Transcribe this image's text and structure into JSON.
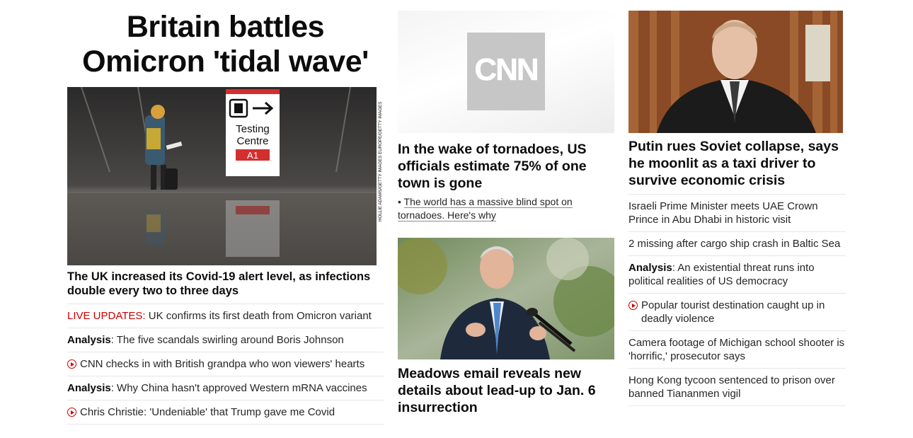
{
  "left": {
    "headline_line1": "Britain battles",
    "headline_line2": "Omicron 'tidal wave'",
    "image_sign_line1": "Testing",
    "image_sign_line2": "Centre",
    "image_sign_gate": "A1",
    "image_credit": "HOLLIE ADAMS/GETTY IMAGES EUROPE/GETTY IMAGES",
    "caption": "The UK increased its Covid-19 alert level, as infections double every two to three days",
    "list": [
      {
        "prefix": "LIVE UPDATES:",
        "text": " UK confirms its first death from Omicron variant",
        "type": "live"
      },
      {
        "prefix": "Analysis",
        "text": ": The five scandals swirling around Boris Johnson",
        "type": "analysis"
      },
      {
        "prefix": "",
        "text": "CNN checks in with British grandpa who won viewers' hearts",
        "type": "video"
      },
      {
        "prefix": "Analysis",
        "text": ": Why China hasn't approved Western mRNA vaccines",
        "type": "analysis"
      },
      {
        "prefix": "",
        "text": "Chris Christie: 'Undeniable' that Trump gave me Covid",
        "type": "video"
      }
    ]
  },
  "middle": {
    "logo_text": "CNN",
    "story1_headline": "In the wake of tornadoes, US officials estimate 75% of one town is gone",
    "story1_sublink": "The world has a massive blind spot on tornadoes. Here's why",
    "story2_headline": "Meadows email reveals new details about lead-up to Jan. 6 insurrection"
  },
  "right": {
    "headline": "Putin rues Soviet collapse, says he moonlit as a taxi driver to survive economic crisis",
    "list": [
      {
        "prefix": "",
        "text": "Israeli Prime Minister meets UAE Crown Prince in Abu Dhabi in historic visit",
        "type": "plain"
      },
      {
        "prefix": "",
        "text": "2 missing after cargo ship crash in Baltic Sea",
        "type": "plain"
      },
      {
        "prefix": "Analysis",
        "text": ": An existential threat runs into political realities of US democracy",
        "type": "analysis"
      },
      {
        "prefix": "",
        "text": "Popular tourist destination caught up in deadly violence",
        "type": "video"
      },
      {
        "prefix": "",
        "text": "Camera footage of Michigan school shooter is 'horrific,' prosecutor says",
        "type": "plain"
      },
      {
        "prefix": "",
        "text": "Hong Kong tycoon sentenced to prison over banned Tiananmen vigil",
        "type": "plain"
      }
    ]
  },
  "colors": {
    "live_red": "#cc0000",
    "headline": "#0c0c0c",
    "body": "#262626",
    "divider": "#e6e6e6"
  }
}
